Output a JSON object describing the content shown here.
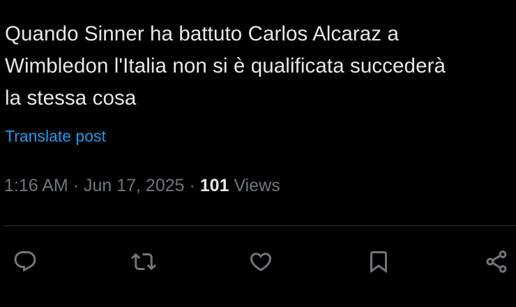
{
  "post": {
    "text_lines": [
      "Quando Sinner ha battuto Carlos Alcaraz a",
      "Wimbledon l'Italia non si è qualificata succederà",
      "la stessa cosa"
    ],
    "translate_label": "Translate post",
    "time": "1:16 AM",
    "separator": "·",
    "date": "Jun 17, 2025",
    "views_count": "101",
    "views_label": "Views"
  },
  "actions": [
    {
      "name": "reply",
      "icon": "reply-icon"
    },
    {
      "name": "repost",
      "icon": "repost-icon"
    },
    {
      "name": "like",
      "icon": "heart-icon"
    },
    {
      "name": "bookmark",
      "icon": "bookmark-icon"
    },
    {
      "name": "share",
      "icon": "share-icon"
    }
  ],
  "colors": {
    "background": "#000000",
    "text": "#e7e9ea",
    "secondary": "#71767b",
    "link": "#1d9bf0",
    "divider": "#2f3336"
  }
}
